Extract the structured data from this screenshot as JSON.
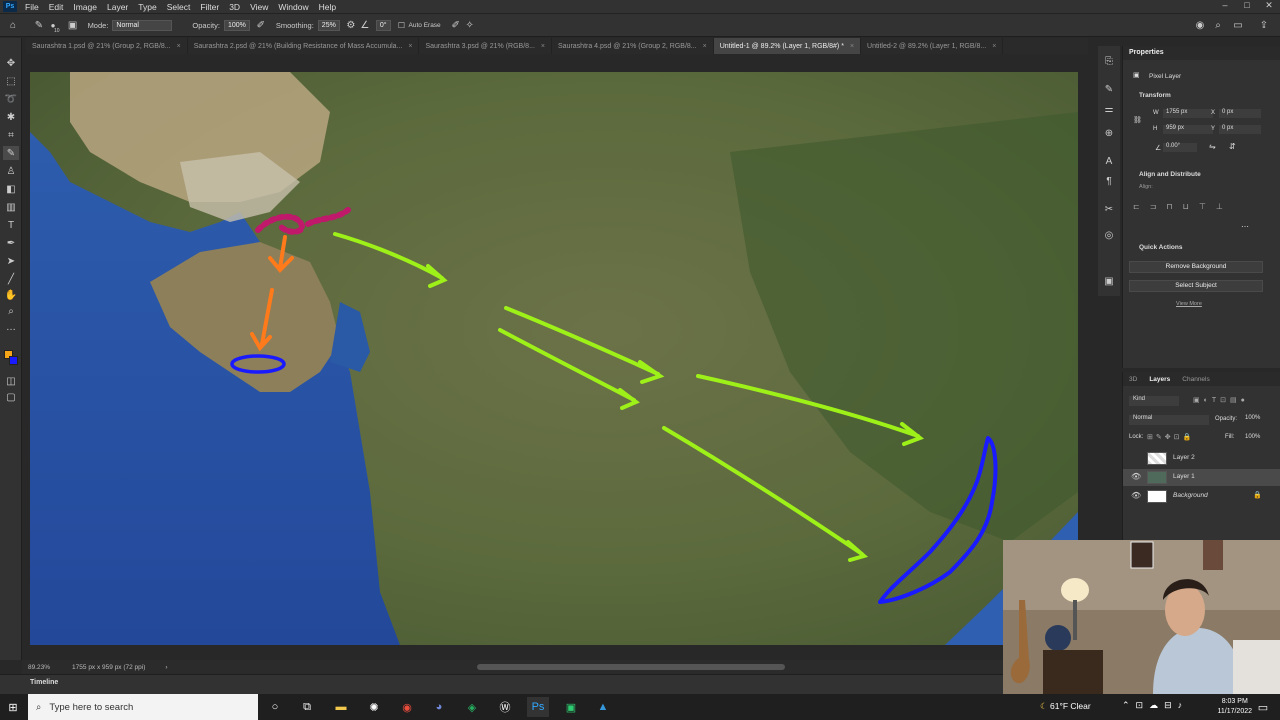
{
  "menu": [
    "File",
    "Edit",
    "Image",
    "Layer",
    "Type",
    "Select",
    "Filter",
    "3D",
    "View",
    "Window",
    "Help"
  ],
  "app_logo": "Ps",
  "options": {
    "mode_label": "Mode:",
    "mode_value": "Normal",
    "opacity_label": "Opacity:",
    "opacity_value": "100%",
    "smoothing_label": "Smoothing:",
    "smoothing_value": "25%",
    "angle_value": "0°",
    "auto_erase": "Auto Erase",
    "brush_size": "10"
  },
  "tabs": [
    {
      "label": "Saurashtra 1.psd @ 21% (Group 2, RGB/8..."
    },
    {
      "label": "Saurashtra 2.psd @ 21% (Building Resistance of Mass Accumula..."
    },
    {
      "label": "Saurashtra 3.psd @ 21% (RGB/8..."
    },
    {
      "label": "Saurashtra 4.psd @ 21% (Group 2, RGB/8..."
    },
    {
      "label": "Untitled-1 @ 89.2% (Layer 1, RGB/8#) *"
    },
    {
      "label": "Untitled-2 @ 89.2% (Layer 1, RGB/8..."
    }
  ],
  "status": {
    "zoom": "89.23%",
    "doc": "1755 px x 959 px (72 ppi)"
  },
  "timeline_label": "Timeline",
  "properties": {
    "tab": "Properties",
    "type": "Pixel Layer",
    "transform": "Transform",
    "w_label": "W",
    "w": "1755 px",
    "h_label": "H",
    "h": "959 px",
    "x_label": "X",
    "x": "0 px",
    "y_label": "Y",
    "y": "0 px",
    "angle": "0.00°",
    "align": "Align and Distribute",
    "align_sub": "Align:",
    "quick": "Quick Actions",
    "remove_bg": "Remove Background",
    "select_subject": "Select Subject",
    "view_more": "View More"
  },
  "layers_panel": {
    "tabs": [
      "3D",
      "Layers",
      "Channels"
    ],
    "kind": "Kind",
    "blend": "Normal",
    "opacity_label": "Opacity:",
    "opacity": "100%",
    "lock_label": "Lock:",
    "fill_label": "Fill:",
    "fill": "100%",
    "layers": [
      {
        "name": "Layer 2"
      },
      {
        "name": "Layer 1"
      },
      {
        "name": "Background"
      }
    ]
  },
  "taskbar": {
    "search_placeholder": "Type here to search",
    "weather": "61°F Clear",
    "time": "8:03 PM",
    "date": "11/17/2022"
  },
  "colors": {
    "panel_bg": "#323232",
    "arrow_green": "#9ef019",
    "arrow_orange": "#ff7a1a",
    "outline_blue": "#1a1aff",
    "dots_magenta": "#c0186a"
  }
}
